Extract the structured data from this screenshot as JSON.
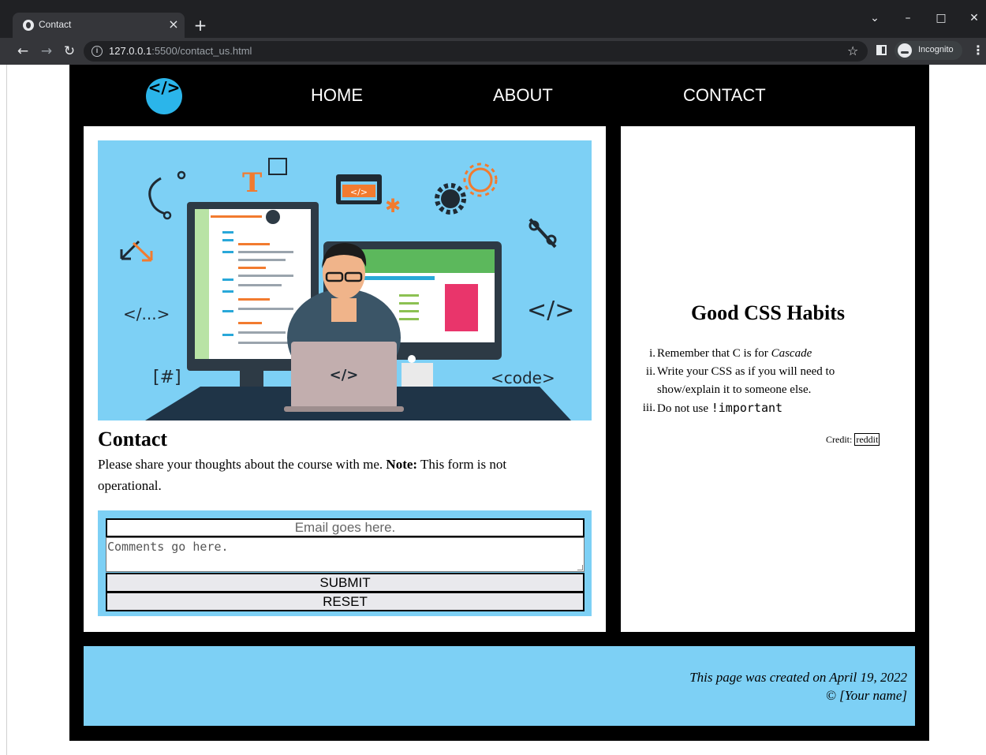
{
  "browser": {
    "tab_title": "Contact",
    "tab_close": "×",
    "new_tab": "+",
    "url_host": "127.0.0.1",
    "url_rest": ":5500/contact_us.html",
    "incognito_label": "Incognito"
  },
  "nav": {
    "home": "HOME",
    "about": "ABOUT",
    "contact": "CONTACT"
  },
  "hero": {
    "label_tag_dots": "</...>",
    "label_tag_close": "</>",
    "label_hash": "[#]",
    "label_code": "<code>",
    "label_window": "</>",
    "label_laptop": "</>",
    "label_t": "T"
  },
  "main": {
    "heading": "Contact",
    "text_before": "Please share your thoughts about the course with me. ",
    "note_label": "Note:",
    "text_after": " This form is not operational.",
    "email_placeholder": "Email goes here.",
    "comments_placeholder": "Comments go here.",
    "submit_label": "SUBMIT",
    "reset_label": "RESET"
  },
  "aside": {
    "heading": "Good CSS Habits",
    "items": [
      {
        "num": "i.",
        "text": "Remember that C is for ",
        "em": "Cascade"
      },
      {
        "num": "ii.",
        "text": "Write your CSS as if you will need to show/explain it to someone else."
      },
      {
        "num": "iii.",
        "text": "Do not use ",
        "code": "!important"
      }
    ],
    "credit_label": "Credit:",
    "credit_link": "reddit"
  },
  "footer": {
    "created": "This page was created on April 19, 2022",
    "copyright": "© [Your name]"
  },
  "colors": {
    "accent_blue": "#7dd0f5",
    "logo_blue": "#2bb5ea",
    "page_bg": "#000000"
  }
}
